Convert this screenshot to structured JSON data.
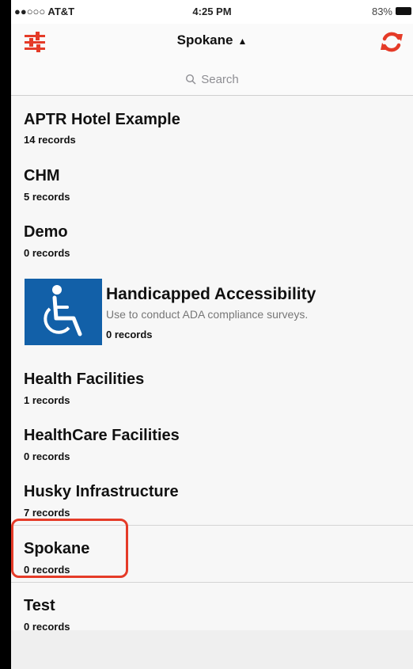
{
  "status_bar": {
    "carrier": "●●○○○ AT&T",
    "time": "4:25 PM",
    "battery": "83%"
  },
  "nav": {
    "title": "Spokane",
    "title_caret": "▲",
    "search_placeholder": "Search",
    "accent_color": "#e53b28"
  },
  "apps": [
    {
      "name": "APTR Hotel Example",
      "count": "14 records"
    },
    {
      "name": "CHM",
      "count": "5 records"
    },
    {
      "name": "Demo",
      "count": "0 records"
    },
    {
      "name": "Handicapped Accessibility",
      "description": "Use to conduct ADA compliance surveys.",
      "count": "0 records",
      "icon": "wheelchair-icon"
    },
    {
      "name": "Health Facilities",
      "count": "1 records"
    },
    {
      "name": "HealthCare Facilities",
      "count": "0 records"
    },
    {
      "name": "Husky Infrastructure",
      "count": "7 records"
    },
    {
      "name": "Spokane",
      "count": "0 records",
      "highlighted": true
    },
    {
      "name": "Test",
      "count": "0 records"
    }
  ]
}
